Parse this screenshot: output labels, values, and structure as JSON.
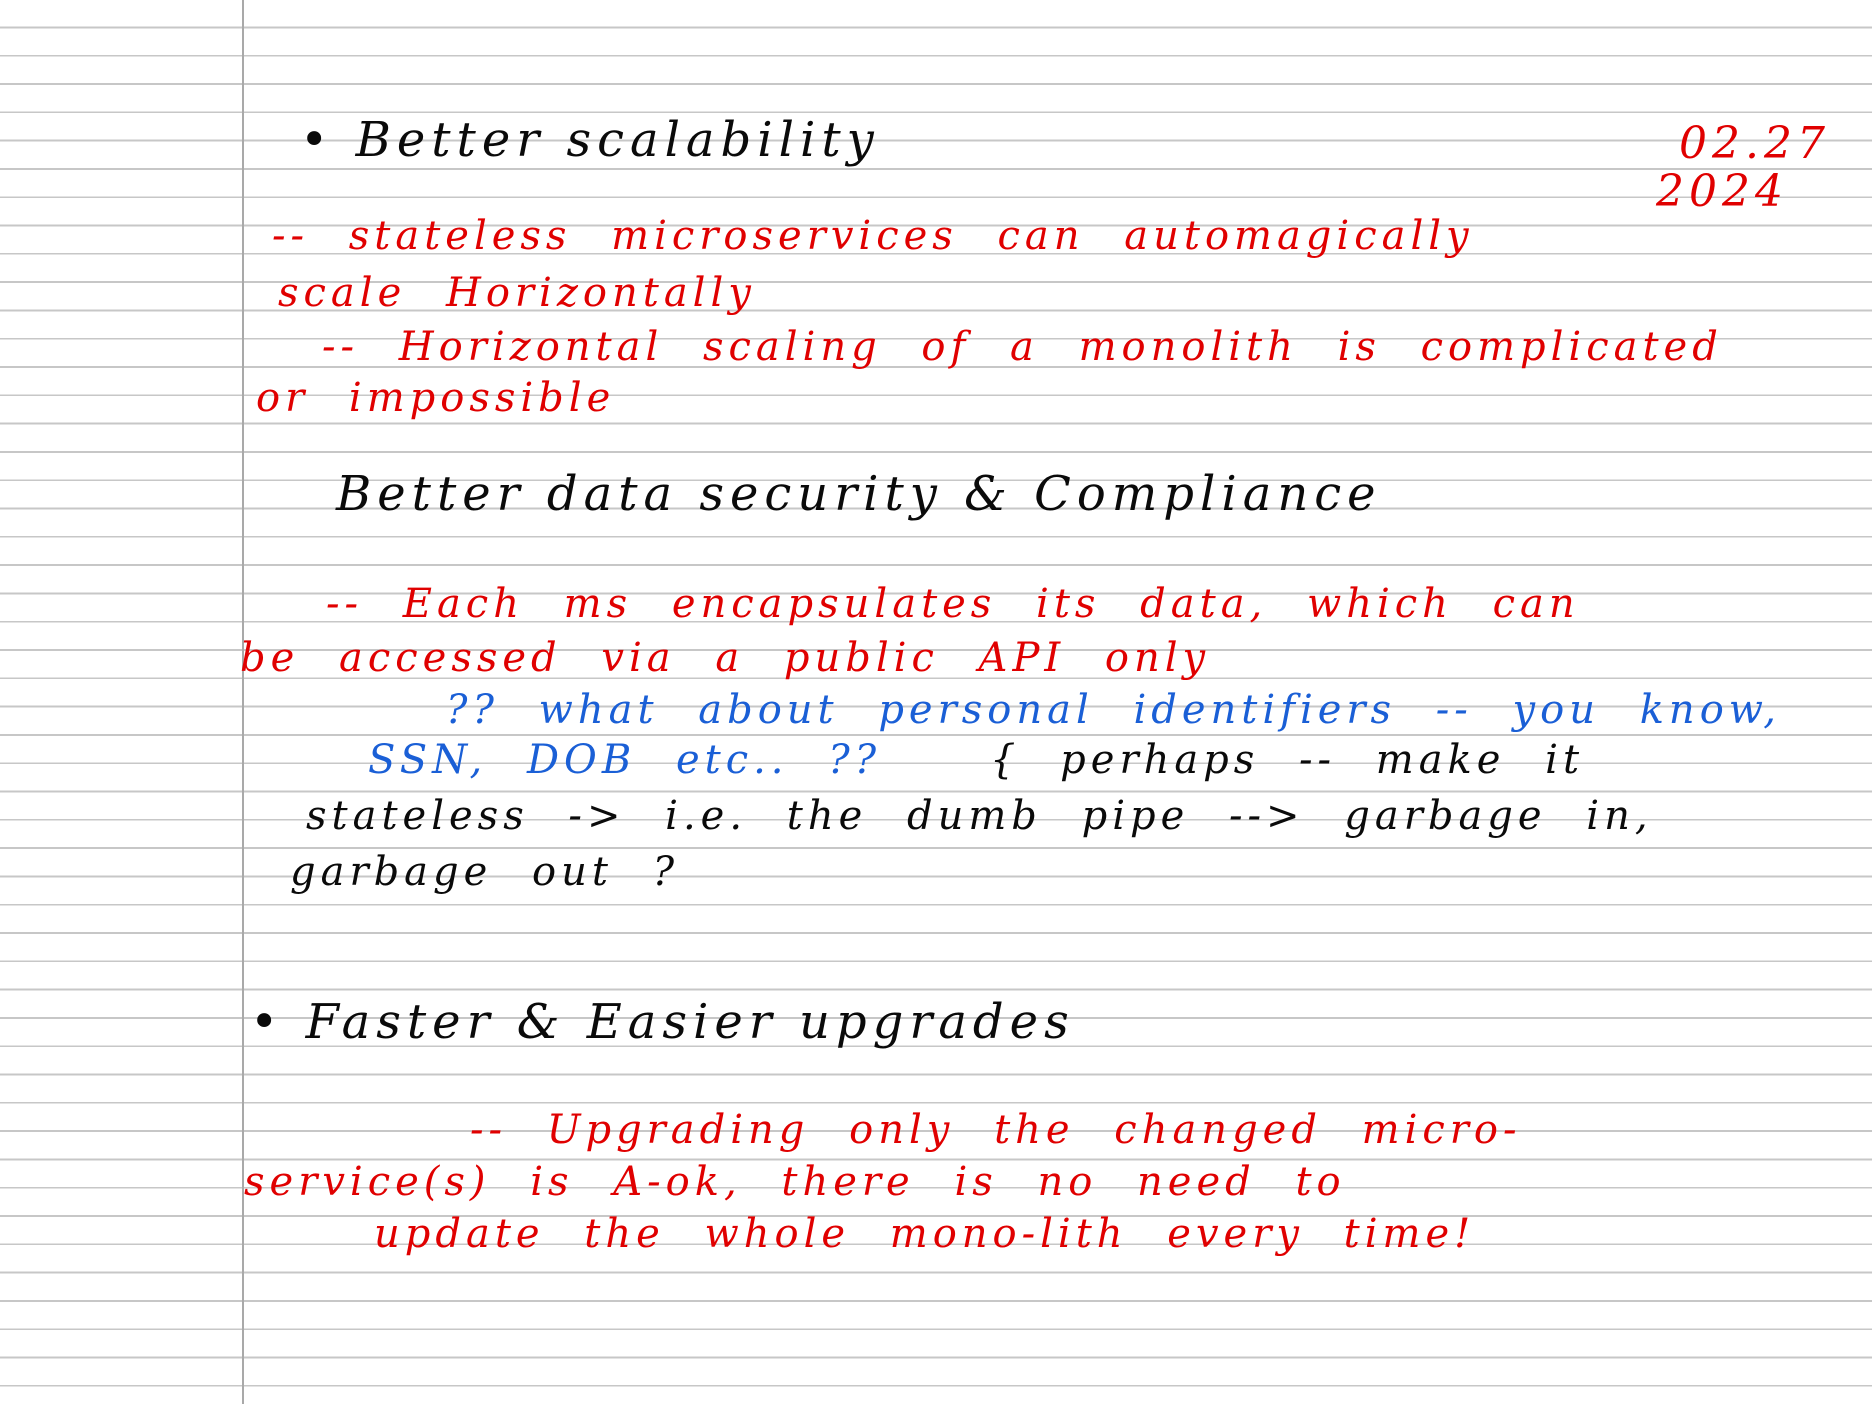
{
  "colors": {
    "ink_black": "#0a0a0a",
    "ink_red": "#e00000",
    "ink_blue": "#1a5fd6",
    "rule_line": "#c7c7c7",
    "margin_line": "#a9a9a9"
  },
  "date": {
    "line1": "02.27",
    "line2": "2024"
  },
  "sections": [
    {
      "heading": "• Better scalability",
      "notes": [
        "-- stateless microservices can automagically",
        "scale Horizontally",
        "-- Horizontal scaling of a monolith is complicated",
        "or impossible"
      ]
    },
    {
      "heading": "Better data security & Compliance",
      "notes": [
        "-- Each ms encapsulates its data, which can",
        "be accessed via a public API only"
      ],
      "question": [
        "?? what about personal identifiers -- you know,",
        "SSN, DOB etc.. ??"
      ],
      "answer": [
        "{ perhaps -- make it",
        "stateless -> i.e. the dumb pipe --> garbage in,",
        "garbage out ?"
      ]
    },
    {
      "heading": "• Faster & Easier upgrades",
      "notes": [
        "-- Upgrading only the changed micro-",
        "service(s) is A-ok, there is no need to",
        "update the whole mono-lith every time!"
      ]
    }
  ]
}
